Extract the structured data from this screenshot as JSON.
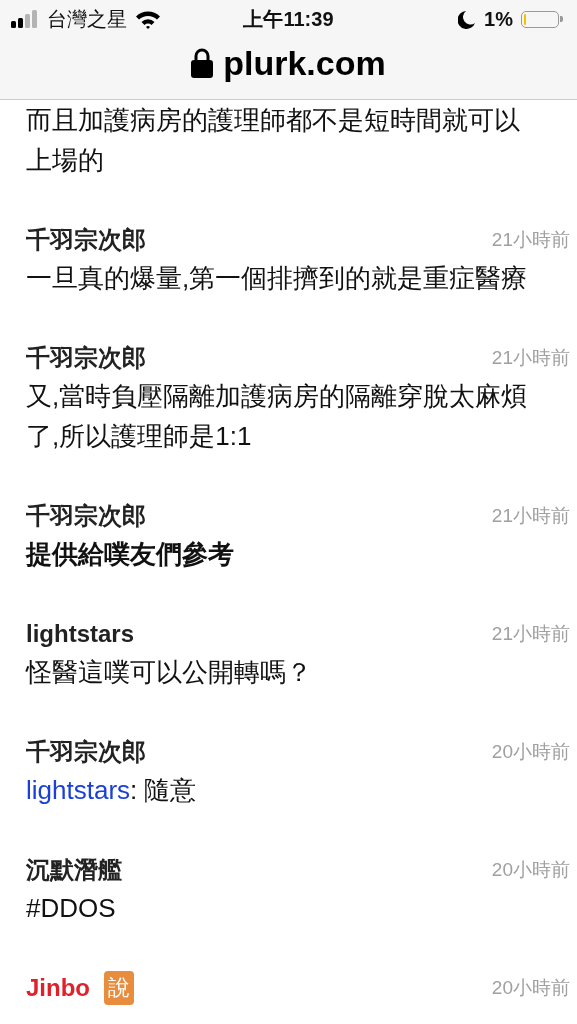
{
  "status_bar": {
    "carrier": "台灣之星",
    "time": "上午11:39",
    "battery": "1%"
  },
  "address_bar": {
    "url": "plurk.com"
  },
  "continued_text": "而且加護病房的護理師都不是短時間就可以上場的",
  "responses": [
    {
      "name": "千羽宗次郎",
      "owner": false,
      "time": "21小時前",
      "bold": false,
      "body": "一旦真的爆量,第一個排擠到的就是重症醫療"
    },
    {
      "name": "千羽宗次郎",
      "owner": false,
      "time": "21小時前",
      "bold": false,
      "body": "又,當時負壓隔離加護病房的隔離穿脫太麻煩了,所以護理師是1:1"
    },
    {
      "name": "千羽宗次郎",
      "owner": false,
      "time": "21小時前",
      "bold": true,
      "body": "提供給噗友們參考"
    },
    {
      "name": "lightstars",
      "owner": false,
      "time": "21小時前",
      "bold": false,
      "body": "怪醫這噗可以公開轉嗎？"
    },
    {
      "name": "千羽宗次郎",
      "owner": false,
      "time": "20小時前",
      "bold": false,
      "mention": "lightstars",
      "body": ": 隨意"
    },
    {
      "name": "沉默潛艦",
      "owner": false,
      "time": "20小時前",
      "bold": false,
      "body": "#DDOS"
    },
    {
      "name": "Jinbo",
      "owner": true,
      "badge": "說",
      "time": "20小時前"
    }
  ]
}
